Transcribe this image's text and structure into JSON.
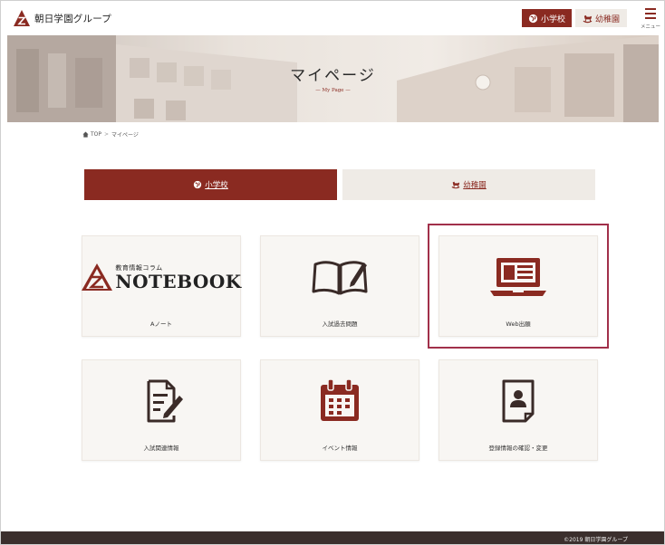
{
  "header": {
    "logo_text": "朝日学園グループ",
    "nav_school_label": "小学校",
    "nav_kinder_label": "幼稚園",
    "menu_label": "メニュー"
  },
  "hero": {
    "title": "マイページ",
    "subtitle": "— My Page —"
  },
  "breadcrumb": {
    "home_label": "TOP",
    "separator": ">",
    "current": "マイページ"
  },
  "tabs": [
    {
      "label": "小学校",
      "active": true
    },
    {
      "label": "幼稚園",
      "active": false
    }
  ],
  "cards": [
    {
      "label": "Aノート",
      "icon": "notebook-logo",
      "logo_small": "教育情報コラム",
      "logo_big": "NOTEBOOK"
    },
    {
      "label": "入試過去問題",
      "icon": "open-book-pen-icon"
    },
    {
      "label": "Web出願",
      "icon": "laptop-icon",
      "selected": true
    },
    {
      "label": "入試関連情報",
      "icon": "document-pen-icon"
    },
    {
      "label": "イベント情報",
      "icon": "calendar-icon"
    },
    {
      "label": "登録情報の確認・変更",
      "icon": "profile-card-icon"
    }
  ],
  "footer": {
    "copyright": "©2019 朝日学園グループ"
  },
  "colors": {
    "brand": "#8a2a21",
    "tab_inactive_bg": "#efebe6",
    "card_bg": "#f8f6f3",
    "selection_outline": "#a1304a",
    "footer_bg": "#3b2f2d"
  }
}
